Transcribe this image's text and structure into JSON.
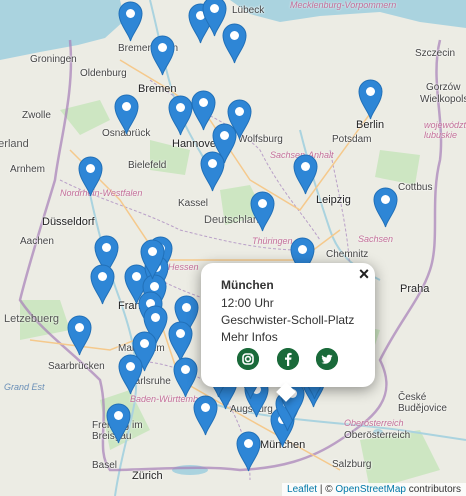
{
  "map": {
    "cities": [
      {
        "name": "Groningen",
        "cls": "city"
      },
      {
        "name": "Bremerhaven",
        "cls": "city"
      },
      {
        "name": "Bremen",
        "cls": "city big"
      },
      {
        "name": "Oldenburg",
        "cls": "city"
      },
      {
        "name": "Zwolle",
        "cls": "city"
      },
      {
        "name": "Osnabrück",
        "cls": "city"
      },
      {
        "name": "Hannover",
        "cls": "city big"
      },
      {
        "name": "Bielefeld",
        "cls": "city"
      },
      {
        "name": "Arnhem",
        "cls": "city"
      },
      {
        "name": "Düsseldorf",
        "cls": "city big"
      },
      {
        "name": "Aachen",
        "cls": "city"
      },
      {
        "name": "Kassel",
        "cls": "city"
      },
      {
        "name": "Leipzig",
        "cls": "city big"
      },
      {
        "name": "Berlin",
        "cls": "city big"
      },
      {
        "name": "Potsdam",
        "cls": "city"
      },
      {
        "name": "Cottbus",
        "cls": "city"
      },
      {
        "name": "Chemnitz",
        "cls": "city"
      },
      {
        "name": "Praha",
        "cls": "city big"
      },
      {
        "name": "Frankfurt",
        "cls": "city big"
      },
      {
        "name": "Mannheim",
        "cls": "city"
      },
      {
        "name": "Saarbrücken",
        "cls": "city"
      },
      {
        "name": "Karlsruhe",
        "cls": "city"
      },
      {
        "name": "Freiburg im Breisgau",
        "cls": "city"
      },
      {
        "name": "Basel",
        "cls": "city"
      },
      {
        "name": "Zürich",
        "cls": "city big"
      },
      {
        "name": "Augsburg",
        "cls": "city"
      },
      {
        "name": "München",
        "cls": "city big"
      },
      {
        "name": "Salzburg",
        "cls": "city"
      },
      {
        "name": "Lübeck",
        "cls": "city"
      },
      {
        "name": "Szczecin",
        "cls": "city"
      },
      {
        "name": "Gorzów",
        "cls": "city"
      },
      {
        "name": "Wielkopolska",
        "cls": "city"
      },
      {
        "name": "Wolfsburg",
        "cls": "city"
      },
      {
        "name": "České Budějovice",
        "cls": "city"
      },
      {
        "name": "Oberösterreich",
        "cls": "city"
      }
    ],
    "regions": [
      "Mecklenburg-Vorpommern",
      "Nordrhein-Westfalen",
      "Sachsen-Anhalt",
      "Thüringen",
      "Sachsen",
      "Baden-Württemberg",
      "Oberösterreich",
      "Hessen",
      "województwo lubuskie"
    ],
    "countries": [
      "Deutschland",
      "Letzebuerg",
      "Nederland",
      "Grand Est"
    ],
    "marker_count": 44
  },
  "popup": {
    "title": "München",
    "time": "12:00 Uhr",
    "location": "Geschwister-Scholl-Platz",
    "more": "Mehr Infos",
    "close": "×",
    "icons": [
      "instagram-icon",
      "facebook-icon",
      "twitter-icon"
    ],
    "icon_color": "#1a6a3a"
  },
  "attribution": {
    "leaflet": "Leaflet",
    "sep": " | © ",
    "osm": "OpenStreetMap",
    "rest": " contributors"
  },
  "colors": {
    "marker": "#2e86d6",
    "marker_dark": "#2170b8",
    "land": "#ecece4",
    "water": "#aad3df"
  }
}
